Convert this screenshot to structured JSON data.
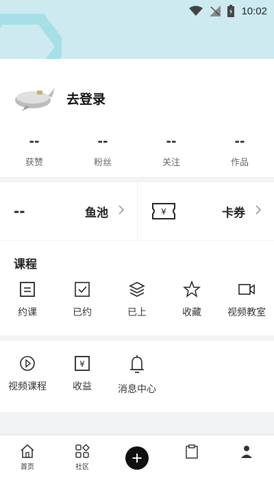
{
  "status_bar": {
    "time": "10:02"
  },
  "profile": {
    "login_label": "去登录",
    "stats": [
      {
        "value": "--",
        "label": "获赞"
      },
      {
        "value": "--",
        "label": "粉丝"
      },
      {
        "value": "--",
        "label": "关注"
      },
      {
        "value": "--",
        "label": "作品"
      }
    ]
  },
  "wallet": {
    "fish_value": "--",
    "fish_label": "鱼池",
    "card_label": "卡券",
    "card_icon_symbol": "¥"
  },
  "courses": {
    "title": "课程",
    "items": [
      {
        "label": "约课",
        "icon": "list-box-icon"
      },
      {
        "label": "已约",
        "icon": "check-box-icon"
      },
      {
        "label": "已上",
        "icon": "layers-icon"
      },
      {
        "label": "收藏",
        "icon": "star-icon"
      },
      {
        "label": "视频教室",
        "icon": "video-camera-icon"
      }
    ]
  },
  "tools": {
    "items": [
      {
        "label": "视频课程",
        "icon": "play-circle-icon"
      },
      {
        "label": "收益",
        "icon": "yen-box-icon",
        "symbol": "¥"
      },
      {
        "label": "消息中心",
        "icon": "bell-icon"
      }
    ]
  },
  "tabbar": {
    "items": [
      {
        "label": "首页",
        "icon": "home-icon"
      },
      {
        "label": "社区",
        "icon": "grid-icon"
      },
      {
        "label": "",
        "icon": "plus-icon"
      },
      {
        "label": "",
        "icon": "clipboard-icon"
      },
      {
        "label": "",
        "icon": "person-icon"
      }
    ]
  }
}
